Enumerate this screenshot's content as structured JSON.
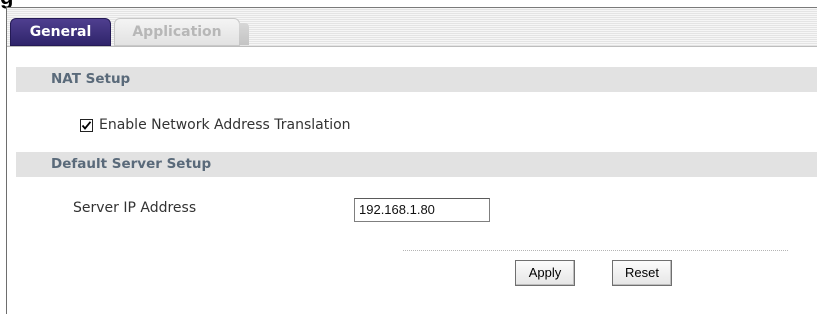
{
  "page": {
    "cut_heading": "g"
  },
  "tabs": [
    {
      "label": "General",
      "active": true
    },
    {
      "label": "Application",
      "active": false
    }
  ],
  "nat_setup": {
    "title": "NAT Setup",
    "checkbox_label": "Enable Network Address Translation",
    "checked": true
  },
  "default_server": {
    "title": "Default Server Setup",
    "ip_label": "Server IP Address",
    "ip_value": "192.168.1.80"
  },
  "actions": {
    "apply_label": "Apply",
    "reset_label": "Reset"
  },
  "colors": {
    "active_tab": "#2f246b",
    "section_bar": "#e2e2e2",
    "section_title": "#5a6a7a"
  },
  "icons": {
    "checkbox": "checkmark-icon"
  }
}
